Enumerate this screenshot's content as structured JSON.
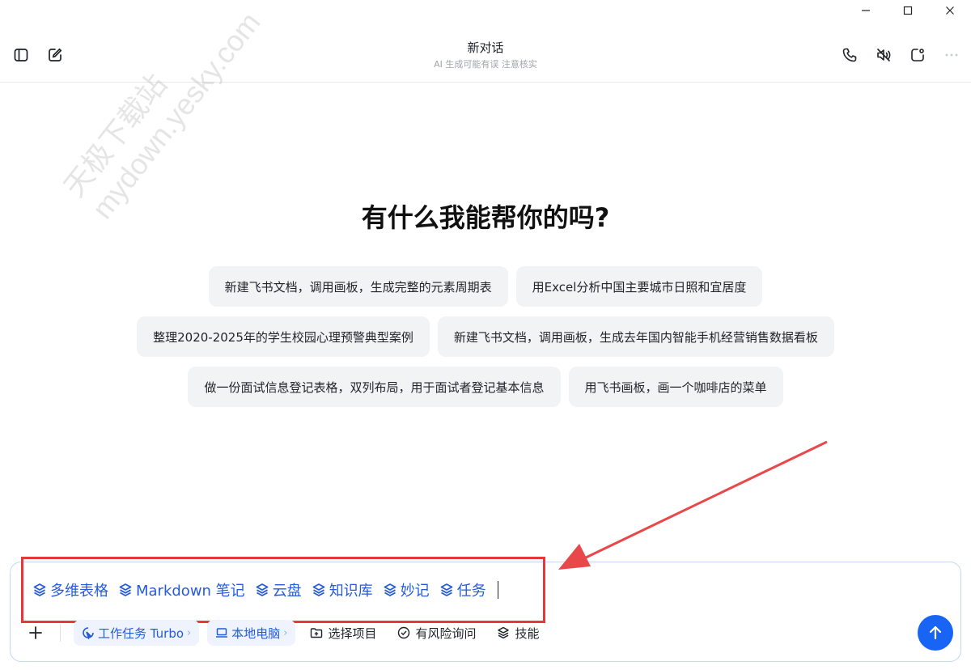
{
  "header": {
    "title": "新对话",
    "subtitle": "AI 生成可能有误 注意核实"
  },
  "watermark": {
    "line1": "天极下载站",
    "line2": "mydown.yesky.com"
  },
  "hero": {
    "title": "有什么我能帮你的吗?"
  },
  "suggestions": [
    [
      "新建飞书文档，调用画板，生成完整的元素周期表",
      "用Excel分析中国主要城市日照和宜居度"
    ],
    [
      "整理2020-2025年的学生校园心理预警典型案例",
      "新建飞书文档，调用画板，生成去年国内智能手机经营销售数据看板"
    ],
    [
      "做一份面试信息登记表格，双列布局，用于面试者登记基本信息",
      "用飞书画板，画一个咖啡店的菜单"
    ]
  ],
  "input": {
    "tags": [
      "多维表格",
      "Markdown 笔记",
      "云盘",
      "知识库",
      "妙记",
      "任务"
    ]
  },
  "toolbar": {
    "mode_label": "工作任务 Turbo",
    "device_label": "本地电脑",
    "project_label": "选择项目",
    "risk_label": "有风险询问",
    "skill_label": "技能"
  },
  "colors": {
    "accent": "#1764f5",
    "tag_blue": "#245bdb",
    "highlight_red": "#e5383b",
    "chip_bg": "#f2f3f5"
  }
}
